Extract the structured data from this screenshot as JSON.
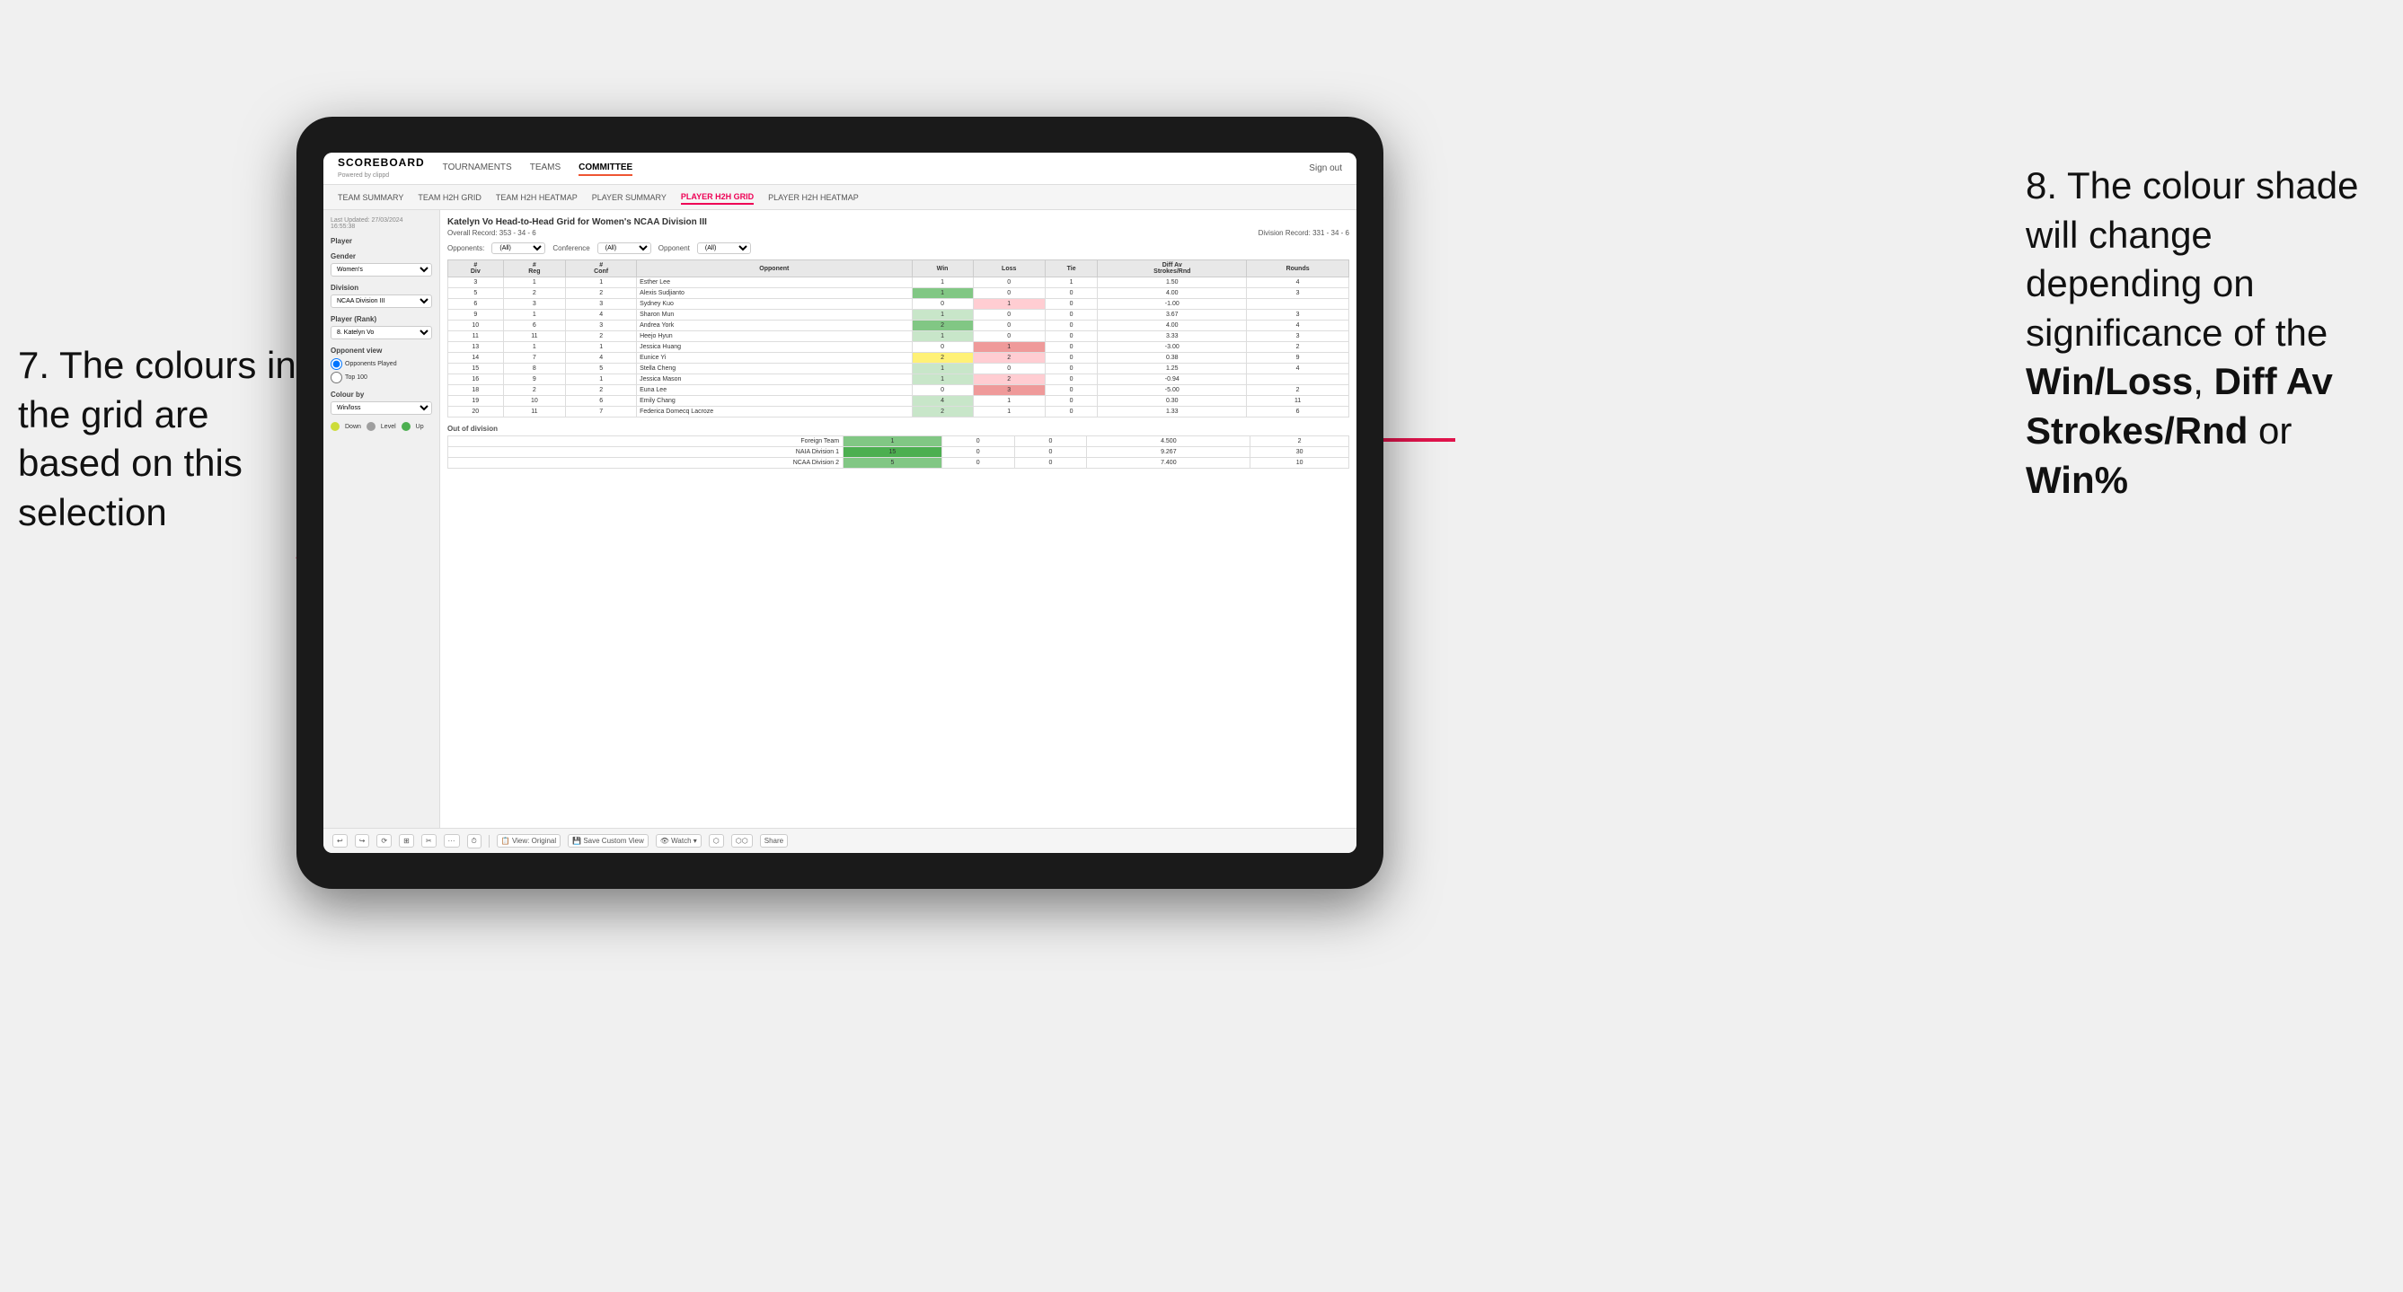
{
  "annotations": {
    "left": "7. The colours in the grid are based on this selection",
    "right_prefix": "8. The colour shade will change depending on significance of the ",
    "right_bold1": "Win/Loss",
    "right_comma": ", ",
    "right_bold2": "Diff Av Strokes/Rnd",
    "right_or": " or ",
    "right_bold3": "Win%"
  },
  "nav": {
    "logo": "SCOREBOARD",
    "logo_sub": "Powered by clippd",
    "items": [
      "TOURNAMENTS",
      "TEAMS",
      "COMMITTEE"
    ],
    "active": "COMMITTEE",
    "sign_in": "Sign out"
  },
  "sub_nav": {
    "items": [
      "TEAM SUMMARY",
      "TEAM H2H GRID",
      "TEAM H2H HEATMAP",
      "PLAYER SUMMARY",
      "PLAYER H2H GRID",
      "PLAYER H2H HEATMAP"
    ],
    "active": "PLAYER H2H GRID"
  },
  "sidebar": {
    "timestamp": "Last Updated: 27/03/2024\n16:55:38",
    "player_label": "Player",
    "gender_label": "Gender",
    "gender_value": "Women's",
    "division_label": "Division",
    "division_value": "NCAA Division III",
    "rank_label": "Player (Rank)",
    "rank_value": "8. Katelyn Vo",
    "opponent_view_label": "Opponent view",
    "radio1": "Opponents Played",
    "radio2": "Top 100",
    "colour_by_label": "Colour by",
    "colour_by_value": "Win/loss",
    "legend": [
      {
        "color": "#cddc39",
        "label": "Down"
      },
      {
        "color": "#9e9e9e",
        "label": "Level"
      },
      {
        "color": "#4caf50",
        "label": "Up"
      }
    ]
  },
  "grid": {
    "title": "Katelyn Vo Head-to-Head Grid for Women's NCAA Division III",
    "overall_record": "Overall Record: 353 - 34 - 6",
    "division_record": "Division Record: 331 - 34 - 6",
    "opponents_label": "Opponents:",
    "opponents_value": "(All)",
    "conference_label": "Conference",
    "conference_value": "(All)",
    "opponent_label": "Opponent",
    "opponent_value": "(All)",
    "col_headers": [
      "#\nDiv",
      "#\nReg",
      "#\nConf",
      "Opponent",
      "Win",
      "Loss",
      "Tie",
      "Diff Av\nStrokes/Rnd",
      "Rounds"
    ],
    "rows": [
      {
        "div": "3",
        "reg": "1",
        "conf": "1",
        "name": "Esther Lee",
        "win": "1",
        "loss": "0",
        "tie": "1",
        "diff": "1.50",
        "rounds": "4",
        "win_color": "neutral",
        "loss_color": "neutral"
      },
      {
        "div": "5",
        "reg": "2",
        "conf": "2",
        "name": "Alexis Sudjianto",
        "win": "1",
        "loss": "0",
        "tie": "0",
        "diff": "4.00",
        "rounds": "3",
        "win_color": "win-green-medium",
        "loss_color": "neutral"
      },
      {
        "div": "6",
        "reg": "3",
        "conf": "3",
        "name": "Sydney Kuo",
        "win": "0",
        "loss": "1",
        "tie": "0",
        "diff": "-1.00",
        "rounds": "",
        "win_color": "neutral",
        "loss_color": "loss-red-light"
      },
      {
        "div": "9",
        "reg": "1",
        "conf": "4",
        "name": "Sharon Mun",
        "win": "1",
        "loss": "0",
        "tie": "0",
        "diff": "3.67",
        "rounds": "3",
        "win_color": "win-green-light",
        "loss_color": "neutral"
      },
      {
        "div": "10",
        "reg": "6",
        "conf": "3",
        "name": "Andrea York",
        "win": "2",
        "loss": "0",
        "tie": "0",
        "diff": "4.00",
        "rounds": "4",
        "win_color": "win-green-medium",
        "loss_color": "neutral"
      },
      {
        "div": "11",
        "reg": "11",
        "conf": "2",
        "name": "Heejo Hyun",
        "win": "1",
        "loss": "0",
        "tie": "0",
        "diff": "3.33",
        "rounds": "3",
        "win_color": "win-green-light",
        "loss_color": "neutral"
      },
      {
        "div": "13",
        "reg": "1",
        "conf": "1",
        "name": "Jessica Huang",
        "win": "0",
        "loss": "1",
        "tie": "0",
        "diff": "-3.00",
        "rounds": "2",
        "win_color": "neutral",
        "loss_color": "loss-red-medium"
      },
      {
        "div": "14",
        "reg": "7",
        "conf": "4",
        "name": "Eunice Yi",
        "win": "2",
        "loss": "2",
        "tie": "0",
        "diff": "0.38",
        "rounds": "9",
        "win_color": "win-yellow",
        "loss_color": "loss-red-light"
      },
      {
        "div": "15",
        "reg": "8",
        "conf": "5",
        "name": "Stella Cheng",
        "win": "1",
        "loss": "0",
        "tie": "0",
        "diff": "1.25",
        "rounds": "4",
        "win_color": "win-green-light",
        "loss_color": "neutral"
      },
      {
        "div": "16",
        "reg": "9",
        "conf": "1",
        "name": "Jessica Mason",
        "win": "1",
        "loss": "2",
        "tie": "0",
        "diff": "-0.94",
        "rounds": "",
        "win_color": "win-green-light",
        "loss_color": "loss-red-light"
      },
      {
        "div": "18",
        "reg": "2",
        "conf": "2",
        "name": "Euna Lee",
        "win": "0",
        "loss": "3",
        "tie": "0",
        "diff": "-5.00",
        "rounds": "2",
        "win_color": "neutral",
        "loss_color": "loss-red-medium"
      },
      {
        "div": "19",
        "reg": "10",
        "conf": "6",
        "name": "Emily Chang",
        "win": "4",
        "loss": "1",
        "tie": "0",
        "diff": "0.30",
        "rounds": "11",
        "win_color": "win-green-light",
        "loss_color": "neutral"
      },
      {
        "div": "20",
        "reg": "11",
        "conf": "7",
        "name": "Federica Domecq Lacroze",
        "win": "2",
        "loss": "1",
        "tie": "0",
        "diff": "1.33",
        "rounds": "6",
        "win_color": "win-green-light",
        "loss_color": "neutral"
      }
    ],
    "out_of_division_label": "Out of division",
    "out_rows": [
      {
        "name": "Foreign Team",
        "win": "1",
        "loss": "0",
        "tie": "0",
        "diff": "4.500",
        "rounds": "2",
        "win_color": "win-green-medium"
      },
      {
        "name": "NAIA Division 1",
        "win": "15",
        "loss": "0",
        "tie": "0",
        "diff": "9.267",
        "rounds": "30",
        "win_color": "win-green-dark"
      },
      {
        "name": "NCAA Division 2",
        "win": "5",
        "loss": "0",
        "tie": "0",
        "diff": "7.400",
        "rounds": "10",
        "win_color": "win-green-medium"
      }
    ]
  },
  "toolbar": {
    "buttons": [
      "↩",
      "↪",
      "⟳",
      "⊞",
      "✂",
      "·",
      "⏱",
      "|",
      "View: Original",
      "Save Custom View",
      "👁 Watch ▾",
      "⬡",
      "⬡⬡",
      "Share"
    ]
  }
}
